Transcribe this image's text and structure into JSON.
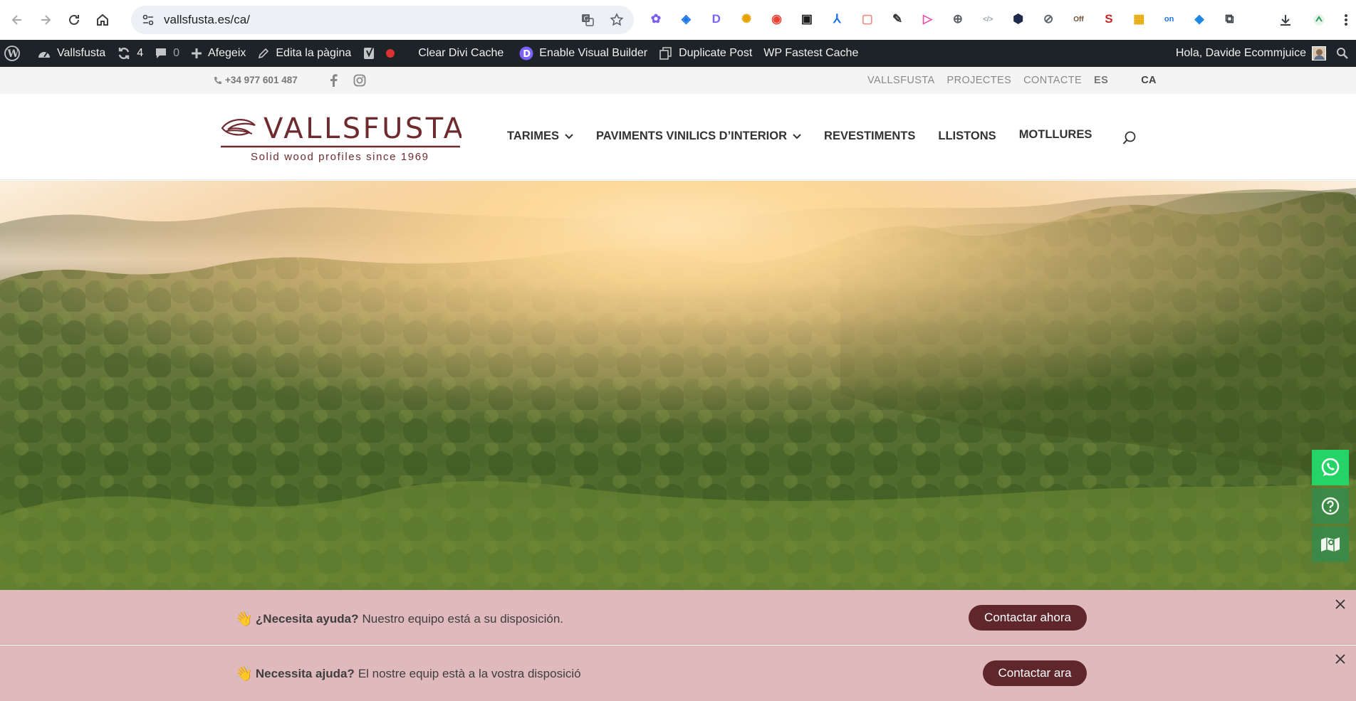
{
  "browser": {
    "url": "vallsfusta.es/ca/",
    "extensions": [
      {
        "icon": "flower-extension-icon",
        "color": "#7b5cf0",
        "glyph": "✿"
      },
      {
        "icon": "tag-extension-icon",
        "color": "#1a73e8",
        "glyph": "◈"
      },
      {
        "icon": "divi-d-extension-icon",
        "color": "#7b61ff",
        "glyph": "D"
      },
      {
        "icon": "sparkle-extension-icon",
        "color": "#e6a300",
        "glyph": "✺"
      },
      {
        "icon": "color-wheel-extension-icon",
        "color": "#e94235",
        "glyph": "◉"
      },
      {
        "icon": "screen-capture-extension-icon",
        "color": "#1a1a1a",
        "glyph": "▣"
      },
      {
        "icon": "tree-extension-icon",
        "color": "#1a73e8",
        "glyph": "⅄"
      },
      {
        "icon": "square-extension-icon",
        "color": "#f28b82",
        "glyph": "▢"
      },
      {
        "icon": "eyedropper-extension-icon",
        "color": "#333333",
        "glyph": "✎"
      },
      {
        "icon": "play-extension-icon",
        "color": "#e94aa8",
        "glyph": "▷"
      },
      {
        "icon": "globe-extension-icon",
        "color": "#5f6368",
        "glyph": "⊕"
      },
      {
        "icon": "code-extension-icon",
        "color": "#9aa0a6",
        "glyph": "</>"
      },
      {
        "icon": "hexagon-extension-icon",
        "color": "#1d2a4a",
        "glyph": "⬢"
      },
      {
        "icon": "link-extension-icon",
        "color": "#5f6368",
        "glyph": "⊘"
      },
      {
        "icon": "off-extension-icon",
        "color": "#6d4c2e",
        "glyph": "Off"
      },
      {
        "icon": "s-extension-icon",
        "color": "#c62828",
        "glyph": "S"
      },
      {
        "icon": "chart-extension-icon",
        "color": "#e6a700",
        "glyph": "▦"
      },
      {
        "icon": "on-extension-icon",
        "color": "#1a73e8",
        "glyph": "on"
      },
      {
        "icon": "diamond-extension-icon",
        "color": "#1e88e5",
        "glyph": "◆"
      },
      {
        "icon": "puzzle-extension-icon",
        "color": "#3c4043",
        "glyph": "⧉"
      }
    ]
  },
  "adminbar": {
    "site_name": "Vallsfusta",
    "updates_count": "4",
    "comments_count": "0",
    "add_new": "Afegeix",
    "edit_page": "Edita la pàgina",
    "clear_cache": "Clear Divi Cache",
    "visual_builder": "Enable Visual Builder",
    "duplicate_post": "Duplicate Post",
    "fastest_cache": "WP Fastest Cache",
    "greeting": "Hola, Davide Ecommjuice"
  },
  "topbar": {
    "phone": "+34 977 601 487",
    "links": [
      "VALLSFUSTA",
      "PROJECTES",
      "CONTACTE"
    ],
    "languages": [
      "ES",
      "CA"
    ]
  },
  "header": {
    "logo_text": "VALLSFUSTA",
    "logo_tagline": "Solid wood profiles since 1969",
    "nav": [
      {
        "label": "TARIMES",
        "dropdown": true
      },
      {
        "label": "PAVIMENTS VINILICS D’INTERIOR",
        "dropdown": true
      },
      {
        "label": "REVESTIMENTS",
        "dropdown": false
      },
      {
        "label": "LLISTONS",
        "dropdown": false
      },
      {
        "label": "MOTLLURES",
        "dropdown": false
      }
    ]
  },
  "floating": {
    "whatsapp_color": "#25d366",
    "help_color": "#3a8b4a",
    "map_color": "#3a8b4a"
  },
  "help_bars": [
    {
      "hand": "👋",
      "bold": "¿Necesita ayuda?",
      "text": "Nuestro equipo está a su disposición.",
      "cta": "Contactar ahora"
    },
    {
      "hand": "👋",
      "bold": "Necessita ajuda?",
      "text": "El nostre equip està a la vostra disposició",
      "cta": "Contactar ara"
    }
  ],
  "colors": {
    "brand": "#6e2b2f",
    "cta_bg": "#5f272b",
    "helpbar_bg": "#e0b9bc",
    "adminbar_bg": "#1d2327"
  }
}
